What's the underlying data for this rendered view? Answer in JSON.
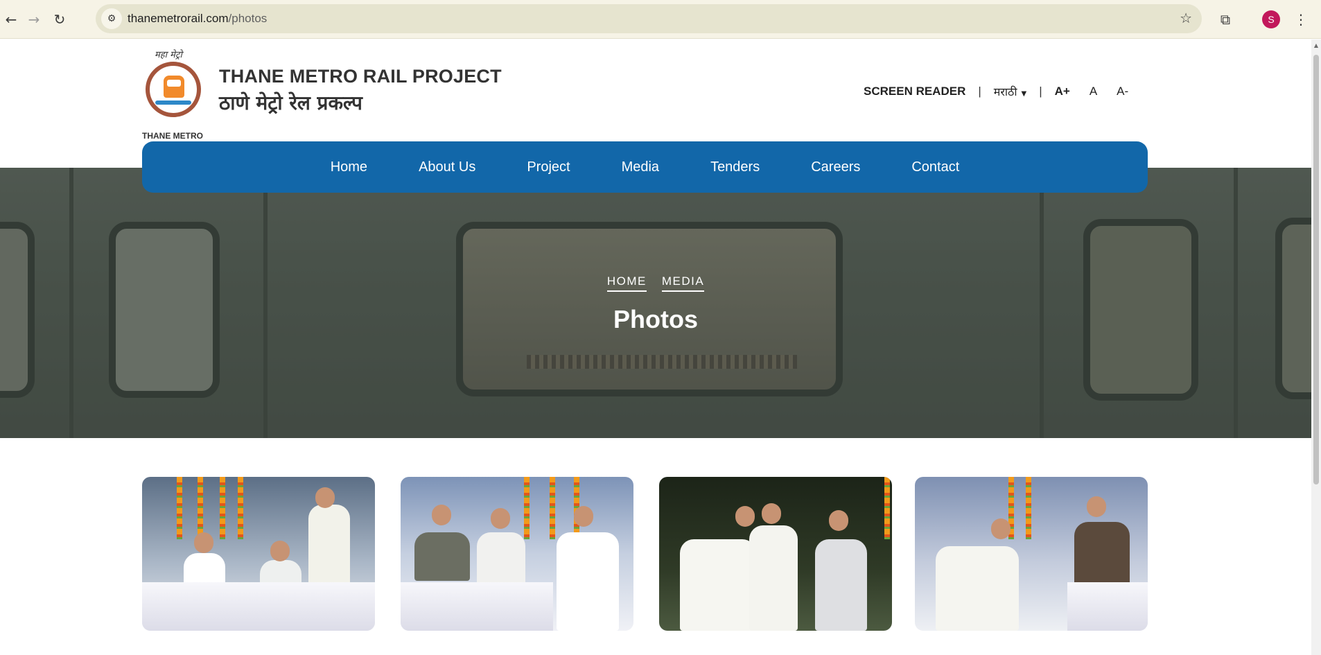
{
  "browser": {
    "url_host": "thanemetrorail.com",
    "url_path": "/photos",
    "profile_initial": "S",
    "icons": [
      "back-icon",
      "forward-icon",
      "reload-icon",
      "site-info-icon",
      "bookmark-star-icon",
      "extensions-icon",
      "profile-avatar",
      "kebab-menu-icon"
    ]
  },
  "header": {
    "logo_top_text": "महा मेट्रो",
    "logo_bottom_text": "THANE METRO",
    "title_en": "THANE METRO RAIL PROJECT",
    "title_mr": "ठाणे मेट्रो रेल प्रकल्प",
    "screen_reader": "SCREEN READER",
    "separator": "|",
    "language": "मराठी",
    "font_larger": "A+",
    "font_normal": "A",
    "font_smaller": "A-"
  },
  "nav": {
    "items": [
      "Home",
      "About Us",
      "Project",
      "Media",
      "Tenders",
      "Careers",
      "Contact"
    ]
  },
  "hero": {
    "breadcrumb": [
      "HOME",
      "MEDIA"
    ],
    "title": "Photos"
  },
  "gallery": {
    "photos": [
      "photo-1",
      "photo-2",
      "photo-3",
      "photo-4"
    ]
  },
  "colors": {
    "nav_bg": "#1267a9",
    "logo_ring": "#a5553c",
    "logo_train": "#f18a2b",
    "avatar": "#c2185b"
  }
}
